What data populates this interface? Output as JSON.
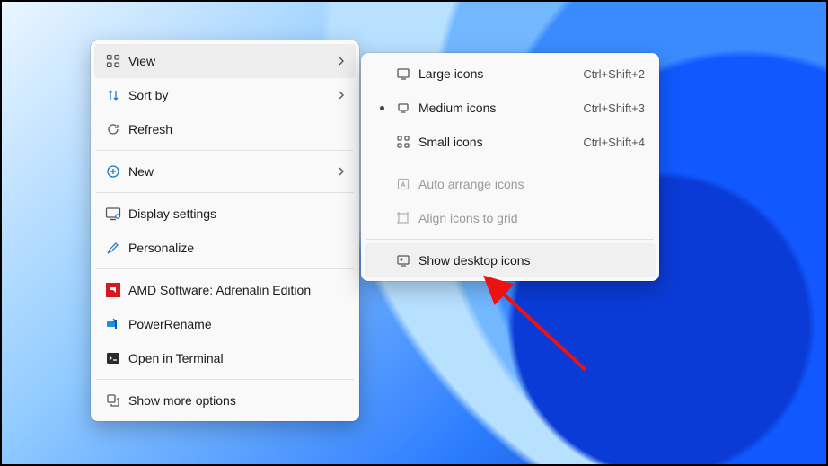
{
  "main_menu": {
    "view": {
      "label": "View"
    },
    "sort_by": {
      "label": "Sort by"
    },
    "refresh": {
      "label": "Refresh"
    },
    "new": {
      "label": "New"
    },
    "display": {
      "label": "Display settings"
    },
    "personalize": {
      "label": "Personalize"
    },
    "amd": {
      "label": "AMD Software: Adrenalin Edition"
    },
    "powerrename": {
      "label": "PowerRename"
    },
    "terminal": {
      "label": "Open in Terminal"
    },
    "more": {
      "label": "Show more options"
    }
  },
  "sub_menu": {
    "large": {
      "label": "Large icons",
      "shortcut": "Ctrl+Shift+2"
    },
    "medium": {
      "label": "Medium icons",
      "shortcut": "Ctrl+Shift+3"
    },
    "small": {
      "label": "Small icons",
      "shortcut": "Ctrl+Shift+4"
    },
    "auto": {
      "label": "Auto arrange icons"
    },
    "align": {
      "label": "Align icons to grid"
    },
    "show": {
      "label": "Show desktop icons"
    }
  }
}
